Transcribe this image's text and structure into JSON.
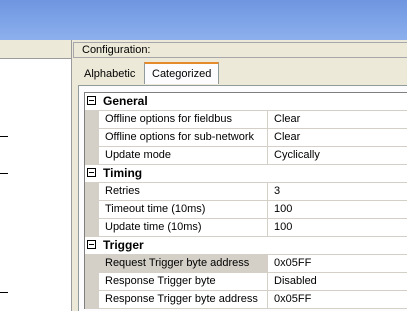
{
  "config": {
    "title": "Configuration:"
  },
  "tabs": [
    {
      "label": "Alphabetic"
    },
    {
      "label": "Categorized"
    }
  ],
  "groups": {
    "general": {
      "title": "General",
      "rows": [
        {
          "name": "Offline options for fieldbus",
          "value": "Clear"
        },
        {
          "name": "Offline options for sub-network",
          "value": "Clear"
        },
        {
          "name": "Update mode",
          "value": "Cyclically"
        }
      ]
    },
    "timing": {
      "title": "Timing",
      "rows": [
        {
          "name": "Retries",
          "value": "3"
        },
        {
          "name": "Timeout time (10ms)",
          "value": "100"
        },
        {
          "name": "Update time (10ms)",
          "value": "100"
        }
      ]
    },
    "trigger": {
      "title": "Trigger",
      "rows": [
        {
          "name": "Request Trigger byte address",
          "value": "0x05FF"
        },
        {
          "name": "Response Trigger byte",
          "value": "Disabled"
        },
        {
          "name": "Response Trigger byte address",
          "value": "0x05FF"
        }
      ]
    }
  }
}
